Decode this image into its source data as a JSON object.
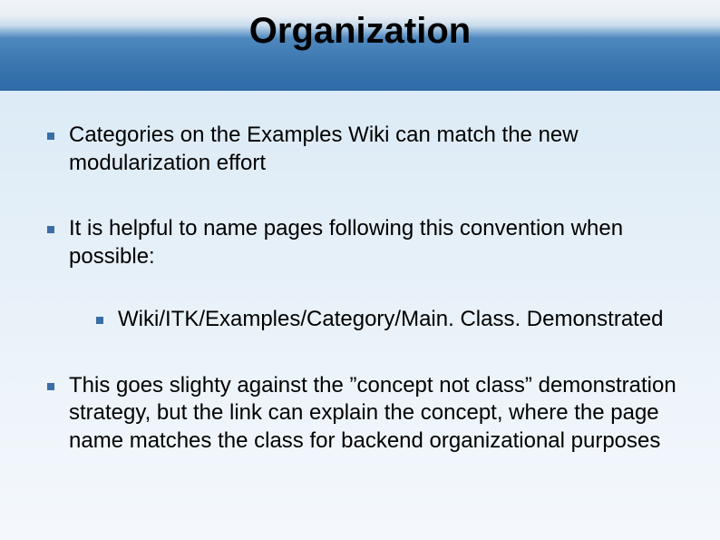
{
  "slide": {
    "title": "Organization",
    "bullets": [
      {
        "text": "Categories on the Examples Wiki can match the new modularization effort"
      },
      {
        "text": "It is helpful to name pages following this convention when possible:",
        "sub": [
          {
            "text": "Wiki/ITK/Examples/Category/Main. Class. Demonstrated"
          }
        ]
      },
      {
        "text": "This goes slighty against the ”concept not class” demonstration strategy, but the link can explain the concept, where the page name matches the class for backend organizational purposes"
      }
    ]
  }
}
